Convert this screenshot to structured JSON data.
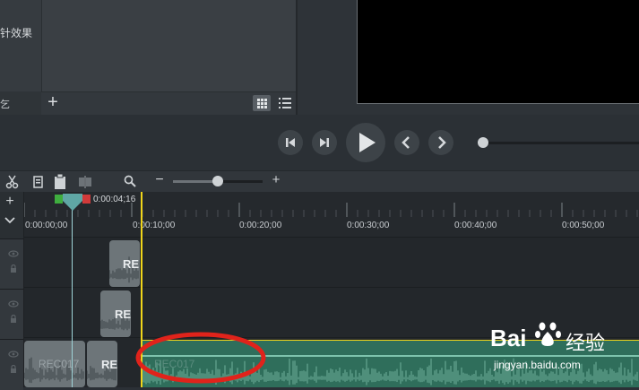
{
  "media_panel": {
    "effect_label": "针效果",
    "left_tab_label": "乞",
    "add_label": "+"
  },
  "timeline": {
    "playhead_time": "0:00:04;16",
    "ruler_labels": [
      "0:00:00;00",
      "0:00:10;00",
      "0:00:20;00",
      "0:00:30;00",
      "0:00:40;00",
      "0:00:50;00"
    ],
    "zoom_out_label": "−",
    "zoom_in_label": "+",
    "zoom_level": 0.48,
    "scrubber_position": 0.0,
    "clips": {
      "track1_clip_label": "RE",
      "track2_clip_label": "RE",
      "track3_clip_a_label": "REC017",
      "track3_clip_b_label": "RE",
      "long_clip_label": "REC017"
    }
  },
  "watermark": {
    "brand": "Bai",
    "brand_suffix": "经验",
    "url": "jingyan.baidu.com"
  },
  "colors": {
    "selection": "#f0d51a",
    "playhead": "#9fd4d8",
    "annotation": "#e0231b",
    "audio_clip": "#2f6e5b"
  },
  "icons": [
    "cut-icon",
    "copy-icon",
    "paste-icon",
    "split-icon",
    "zoom-icon",
    "grid-view-icon",
    "list-view-icon",
    "eye-icon",
    "lock-icon",
    "add-track-icon",
    "collapse-icon"
  ]
}
